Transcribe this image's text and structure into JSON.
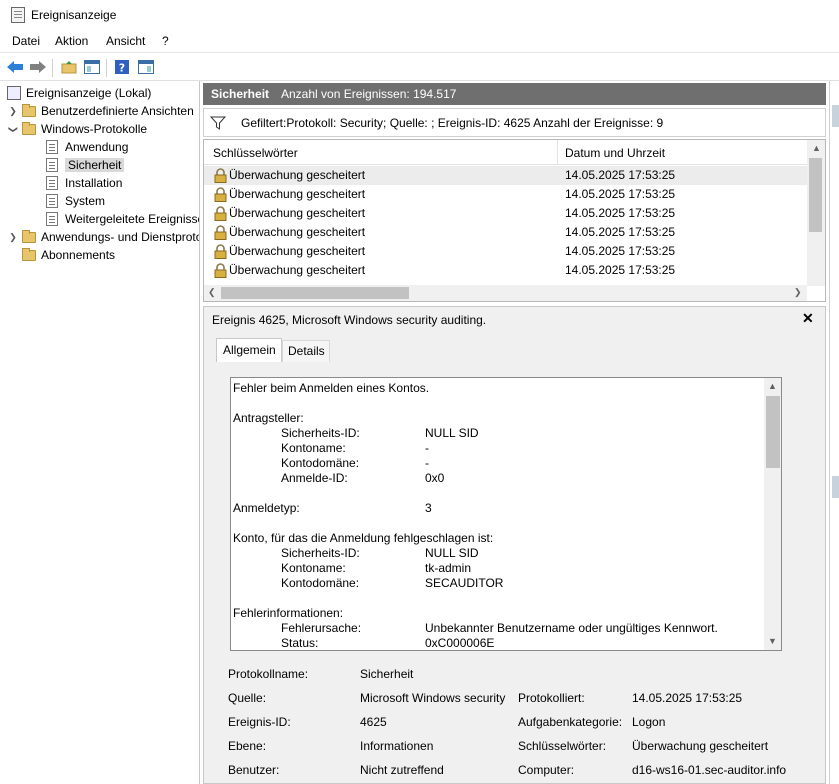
{
  "window": {
    "title": "Ereignisanzeige"
  },
  "menu": [
    "Datei",
    "Aktion",
    "Ansicht",
    "?"
  ],
  "toolbar": [
    "back-arrow-icon",
    "forward-arrow-icon",
    "folder-up-icon",
    "show-pane-icon",
    "help-icon",
    "action-pane-icon"
  ],
  "tree": {
    "root": "Ereignisanzeige (Lokal)",
    "custom_views": "Benutzerdefinierte Ansichten",
    "windows_logs": "Windows-Protokolle",
    "application": "Anwendung",
    "security": "Sicherheit",
    "setup": "Installation",
    "system": "System",
    "forwarded": "Weitergeleitete Ereignisse",
    "apps_services": "Anwendungs- und Dienstprotokolle",
    "subscriptions": "Abonnements"
  },
  "header": {
    "title": "Sicherheit",
    "count": "Anzahl von Ereignissen: 194.517"
  },
  "filter": {
    "text": "Gefiltert:Protokoll: Security; Quelle: ; Ereignis-ID: 4625 Anzahl der Ereignisse: 9"
  },
  "list": {
    "columns": [
      "Schlüsselwörter",
      "Datum und Uhrzeit"
    ],
    "rows": [
      {
        "keyword": "Überwachung gescheitert",
        "datetime": "14.05.2025 17:53:25"
      },
      {
        "keyword": "Überwachung gescheitert",
        "datetime": "14.05.2025 17:53:25"
      },
      {
        "keyword": "Überwachung gescheitert",
        "datetime": "14.05.2025 17:53:25"
      },
      {
        "keyword": "Überwachung gescheitert",
        "datetime": "14.05.2025 17:53:25"
      },
      {
        "keyword": "Überwachung gescheitert",
        "datetime": "14.05.2025 17:53:25"
      },
      {
        "keyword": "Überwachung gescheitert",
        "datetime": "14.05.2025 17:53:25"
      }
    ]
  },
  "detail": {
    "title": "Ereignis 4625, Microsoft Windows security auditing.",
    "tabs": [
      "Allgemein",
      "Details"
    ],
    "description": {
      "intro": "Fehler beim Anmelden eines Kontos.",
      "subject_heading": "Antragsteller:",
      "subject": [
        {
          "k": "Sicherheits-ID:",
          "v": "NULL SID"
        },
        {
          "k": "Kontoname:",
          "v": "-"
        },
        {
          "k": "Kontodomäne:",
          "v": "-"
        },
        {
          "k": "Anmelde-ID:",
          "v": "0x0"
        }
      ],
      "logon_type_label": "Anmeldetyp:",
      "logon_type": "3",
      "account_heading": "Konto, für das die Anmeldung fehlgeschlagen ist:",
      "account": [
        {
          "k": "Sicherheits-ID:",
          "v": "NULL SID"
        },
        {
          "k": "Kontoname:",
          "v": "tk-admin"
        },
        {
          "k": "Kontodomäne:",
          "v": "SECAUDITOR"
        }
      ],
      "failure_heading": "Fehlerinformationen:",
      "failure": [
        {
          "k": "Fehlerursache:",
          "v": "Unbekannter Benutzername oder ungültiges Kennwort."
        },
        {
          "k": "Status:",
          "v": "0xC000006E"
        }
      ]
    },
    "props": {
      "log_name_label": "Protokollname:",
      "log_name": "Sicherheit",
      "source_label": "Quelle:",
      "source": "Microsoft Windows security",
      "logged_label": "Protokolliert:",
      "logged": "14.05.2025 17:53:25",
      "event_id_label": "Ereignis-ID:",
      "event_id": "4625",
      "task_label": "Aufgabenkategorie:",
      "task": "Logon",
      "level_label": "Ebene:",
      "level": "Informationen",
      "keywords_label": "Schlüsselwörter:",
      "keywords": "Überwachung gescheitert",
      "user_label": "Benutzer:",
      "user": "Nicht zutreffend",
      "computer_label": "Computer:",
      "computer": "d16-ws16-01.sec-auditor.info"
    }
  }
}
